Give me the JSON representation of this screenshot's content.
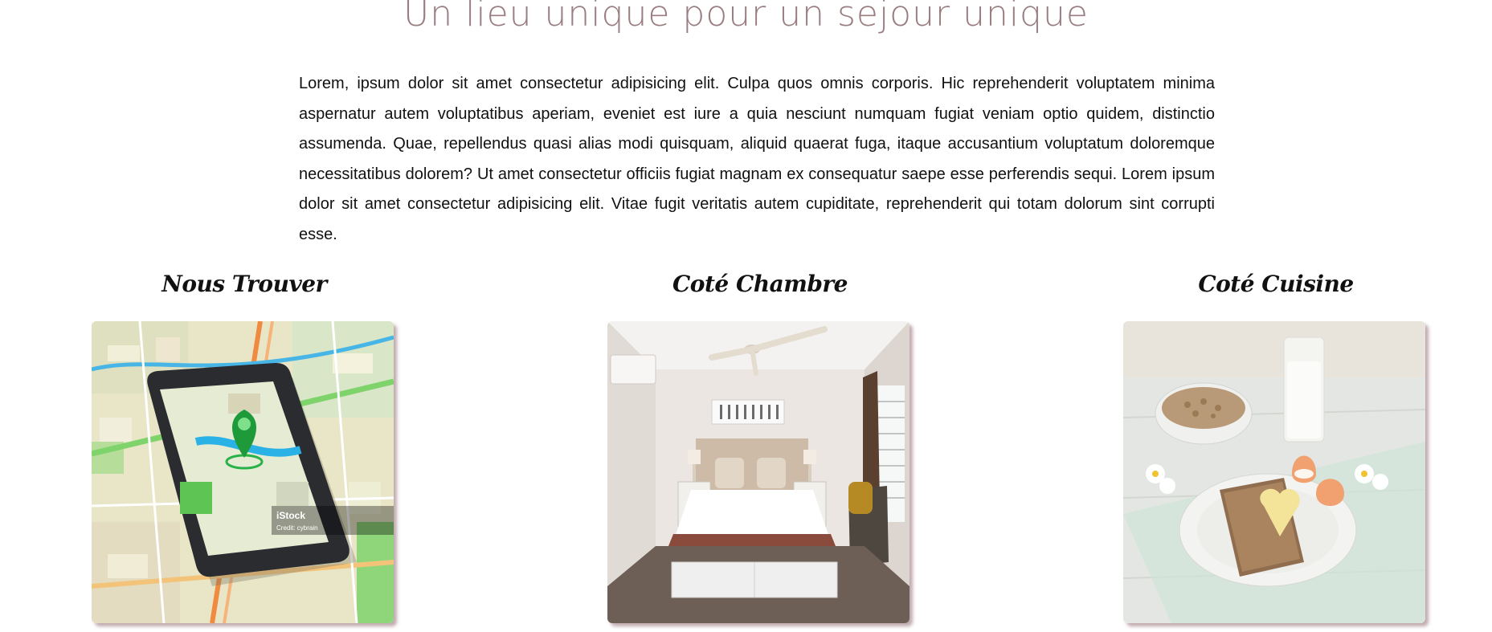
{
  "section": {
    "title": "Un lieu unique pour un sejour unique",
    "intro": "Lorem, ipsum dolor sit amet consectetur adipisicing elit. Culpa quos omnis corporis. Hic reprehenderit voluptatem minima aspernatur autem voluptatibus aperiam, eveniet est iure a quia nesciunt numquam fugiat veniam optio quidem, distinctio assumenda. Quae, repellendus quasi alias modi quisquam, aliquid quaerat fuga, itaque accusantium voluptatum doloremque necessitatibus dolorem? Ut amet consectetur officiis fugiat magnam ex consequatur saepe esse perferendis sequi. Lorem ipsum dolor sit amet consectetur adipisicing elit. Vitae fugit veritatis autem cupiditate, reprehenderit qui totam dolorum sint corrupti esse."
  },
  "cards": [
    {
      "title": "Nous Trouver",
      "photo": "map-phone-photo",
      "watermark": "iStock",
      "credit": "Credit: cybrain"
    },
    {
      "title": "Coté Chambre",
      "photo": "bedroom-photo"
    },
    {
      "title": "Coté Cuisine",
      "photo": "breakfast-photo"
    }
  ],
  "colors": {
    "heading": "#9a7d80",
    "text": "#111111",
    "photo_shadow": "#8c646e"
  }
}
